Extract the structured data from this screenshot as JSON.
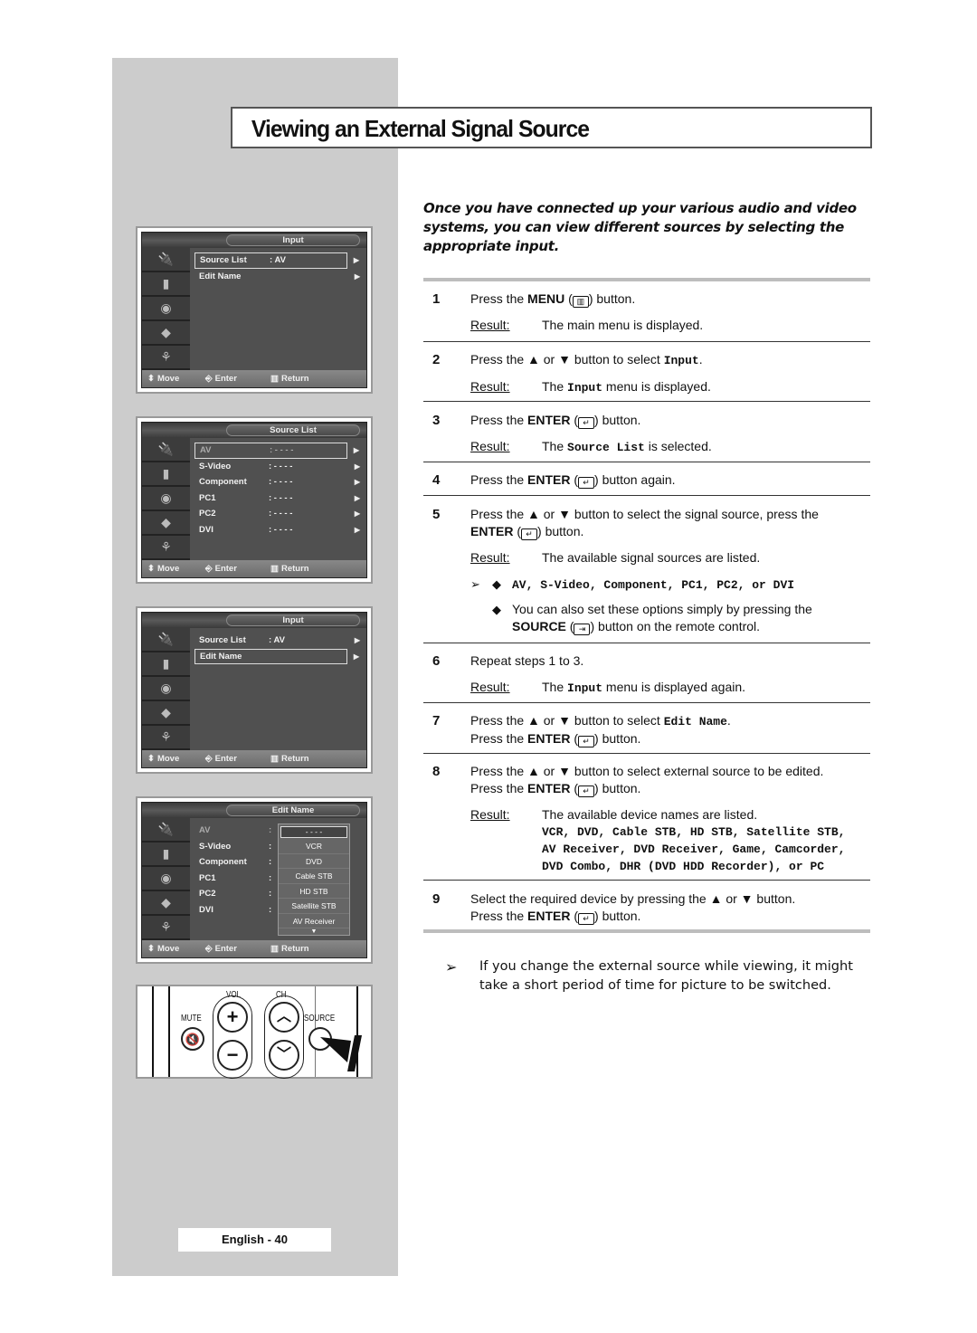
{
  "page": {
    "title": "Viewing an External Signal Source",
    "intro": "Once you have connected up your various audio and video systems, you can view different sources by selecting the appropriate input.",
    "footer": "English - 40"
  },
  "osd_common": {
    "move": "Move",
    "enter": "Enter",
    "return": "Return"
  },
  "screens": [
    {
      "title": "Input",
      "rows": [
        {
          "label": "Source List",
          "value": ": AV",
          "selected": true
        },
        {
          "label": "Edit Name",
          "value": "",
          "selected": false
        }
      ]
    },
    {
      "title": "Source List",
      "rows": [
        {
          "label": "AV",
          "value": ": - - - -",
          "selected": true
        },
        {
          "label": "S-Video",
          "value": ": - - - -"
        },
        {
          "label": "Component",
          "value": ": - - - -"
        },
        {
          "label": "PC1",
          "value": ": - - - -"
        },
        {
          "label": "PC2",
          "value": ": - - - -"
        },
        {
          "label": "DVI",
          "value": ": - - - -"
        }
      ]
    },
    {
      "title": "Input",
      "rows": [
        {
          "label": "Source List",
          "value": ": AV",
          "selected": false
        },
        {
          "label": "Edit Name",
          "value": "",
          "selected": true
        }
      ]
    },
    {
      "title": "Edit Name",
      "rows": [
        {
          "label": "AV",
          "value": ":"
        },
        {
          "label": "S-Video",
          "value": ":"
        },
        {
          "label": "Component",
          "value": ":"
        },
        {
          "label": "PC1",
          "value": ":"
        },
        {
          "label": "PC2",
          "value": ":"
        },
        {
          "label": "DVI",
          "value": ":"
        }
      ],
      "dropdown": [
        "- - - -",
        "VCR",
        "DVD",
        "Cable STB",
        "HD STB",
        "Satellite STB",
        "AV Receiver"
      ]
    }
  ],
  "remote": {
    "vol": "VOL",
    "ch": "CH",
    "mute": "MUTE",
    "source": "SOURCE"
  },
  "steps": [
    {
      "num": "1",
      "pre": "Press the ",
      "key": "MENU",
      "post": " button.",
      "result_label": "Result:",
      "result": "The main menu is displayed."
    },
    {
      "num": "2",
      "text_a": "Press the ▲ or ▼ button to select ",
      "code": "Input",
      "text_b": ".",
      "result_label": "Result:",
      "result_a": "The ",
      "result_code": "Input",
      "result_b": " menu is displayed."
    },
    {
      "num": "3",
      "pre": "Press the ",
      "key": "ENTER",
      "post": " button.",
      "result_label": "Result:",
      "result_a": "The ",
      "result_code": "Source List",
      "result_b": " is selected."
    },
    {
      "num": "4",
      "pre": "Press the ",
      "key": "ENTER",
      "post": " button again."
    },
    {
      "num": "5",
      "text": "Press the ▲ or ▼ button to select the signal source, press the",
      "key": "ENTER",
      "post": " button.",
      "result_label": "Result:",
      "result": "The available signal sources are listed.",
      "bullets": [
        "AV, S-Video, Component, PC1, PC2, or DVI",
        "You can also set these options simply by pressing the"
      ],
      "source_key": "SOURCE",
      "source_post": " button on the remote control."
    },
    {
      "num": "6",
      "text": "Repeat steps 1 to 3.",
      "result_label": "Result:",
      "result_a": "The ",
      "result_code": "Input",
      "result_b": " menu is displayed again."
    },
    {
      "num": "7",
      "text_a": "Press the ▲ or ▼ button to select ",
      "code": "Edit Name",
      "text_b": ".",
      "pre": "Press the ",
      "key": "ENTER",
      "post": " button."
    },
    {
      "num": "8",
      "text": "Press the ▲ or ▼ button to select external source to be edited.",
      "pre": "Press the ",
      "key": "ENTER",
      "post": " button.",
      "result_label": "Result:",
      "result": "The available device names are listed.",
      "devices_1": "VCR, DVD, Cable STB, HD STB, Satellite STB,",
      "devices_2": "AV Receiver, DVD Receiver, Game, Camcorder,",
      "devices_3": "DVD Combo, DHR (DVD HDD Recorder), or PC"
    },
    {
      "num": "9",
      "text": "Select the required device by pressing the ▲ or ▼ button.",
      "pre": "Press the ",
      "key": "ENTER",
      "post": " button."
    }
  ],
  "note": "If you change the external source while viewing, it might take a short period of time for picture to be switched.",
  "icons": {
    "arrow": "➢",
    "diamond": "◆",
    "menu": "menu-icon",
    "enter": "enter-icon"
  }
}
